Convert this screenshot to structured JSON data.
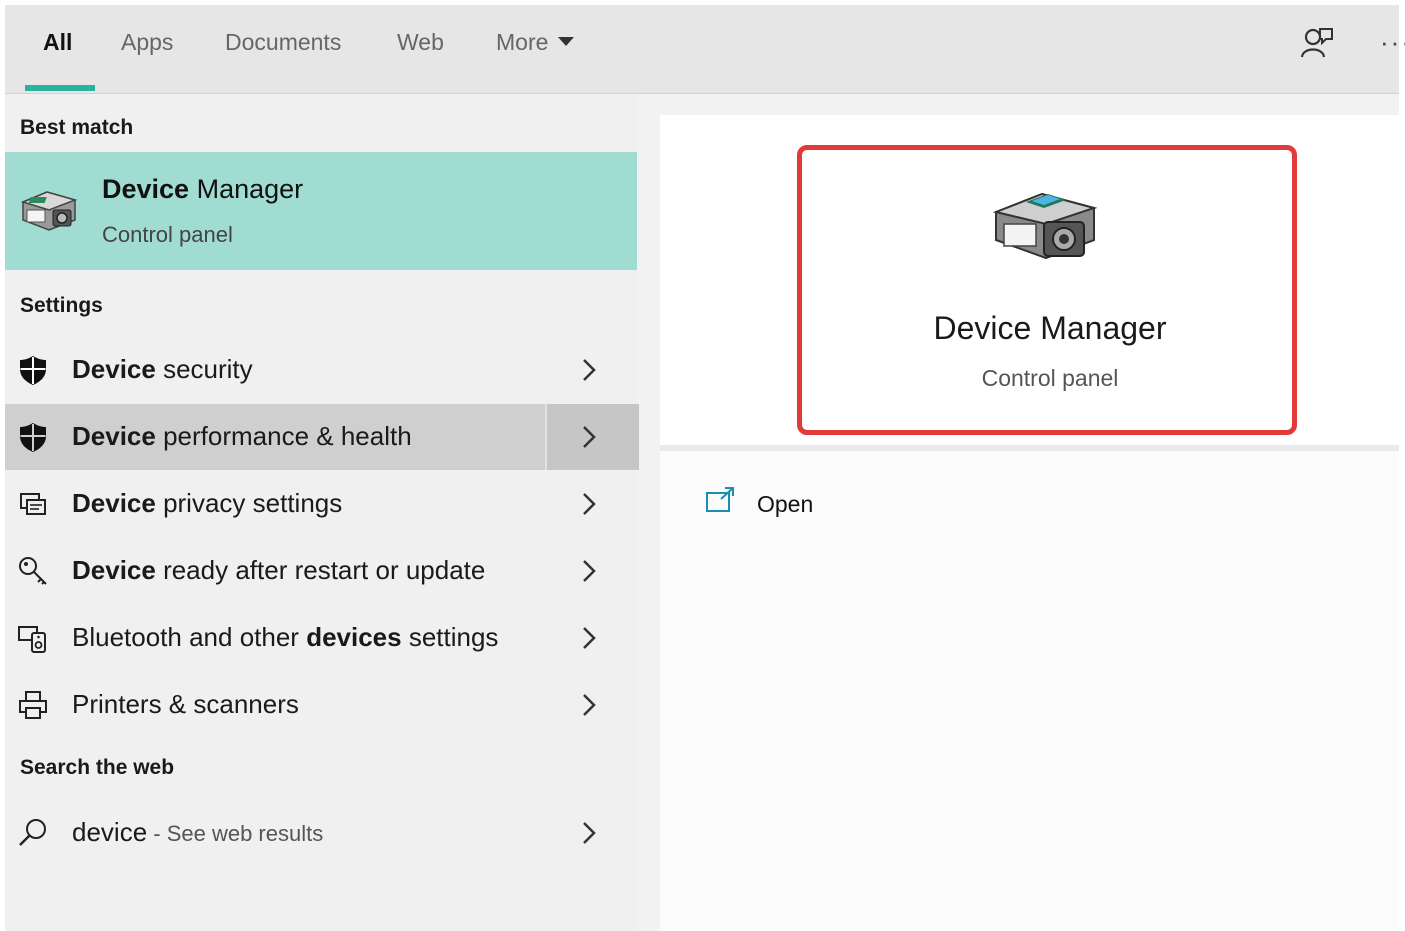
{
  "tabs": [
    {
      "label": "All",
      "active": true
    },
    {
      "label": "Apps"
    },
    {
      "label": "Documents"
    },
    {
      "label": "Web"
    },
    {
      "label": "More"
    }
  ],
  "toolbar": {
    "feedback_icon": "feedback-person-icon",
    "more_label": "···"
  },
  "sections": {
    "best_match": "Best match",
    "settings": "Settings",
    "web": "Search the web"
  },
  "best_match": {
    "title_bold": "Device",
    "title_rest": " Manager",
    "subtitle": "Control panel",
    "icon": "device-manager-icon"
  },
  "settings_items": [
    {
      "bold": "Device",
      "rest": " security",
      "icon": "shield-icon"
    },
    {
      "bold": "Device",
      "rest": " performance & health",
      "icon": "shield-icon"
    },
    {
      "bold": "Device",
      "rest": " privacy settings",
      "icon": "privacy-icon"
    },
    {
      "bold": "Device",
      "rest": " ready after restart or update",
      "icon": "key-icon"
    },
    {
      "pre": "Bluetooth and other ",
      "bold": "devices",
      "rest": " settings",
      "icon": "bluetooth-devices-icon"
    },
    {
      "rest": "Printers & scanners",
      "icon": "printer-icon"
    }
  ],
  "web_result": {
    "query": "device",
    "suffix": " - See web results",
    "icon": "search-icon"
  },
  "preview": {
    "title": "Device Manager",
    "subtitle": "Control panel",
    "open_label": "Open"
  },
  "colors": {
    "accent": "#2bb3a2",
    "best_match_bg": "#a0dcd2",
    "highlight_box": "#e23a3a"
  }
}
